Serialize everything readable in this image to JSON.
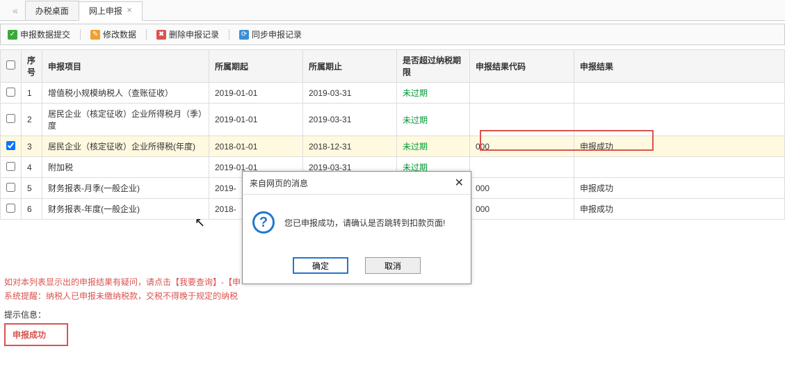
{
  "tabs": {
    "tab1": "办税桌面",
    "tab2": "网上申报"
  },
  "toolbar": {
    "submit": "申报数据提交",
    "modify": "修改数据",
    "delete": "删除申报记录",
    "sync": "同步申报记录"
  },
  "headers": {
    "seq": "序号",
    "item": "申报项目",
    "start": "所属期起",
    "end": "所属期止",
    "over": "是否超过纳税期限",
    "code": "申报结果代码",
    "result": "申报结果"
  },
  "rows": [
    {
      "seq": "1",
      "item": "增值税小规模纳税人（查账征收）",
      "start": "2019-01-01",
      "end": "2019-03-31",
      "over": "未过期",
      "code": "",
      "result": "",
      "checked": false
    },
    {
      "seq": "2",
      "item": "居民企业（核定征收）企业所得税月（季）度",
      "start": "2019-01-01",
      "end": "2019-03-31",
      "over": "未过期",
      "code": "",
      "result": "",
      "checked": false
    },
    {
      "seq": "3",
      "item": "居民企业（核定征收）企业所得税(年度)",
      "start": "2018-01-01",
      "end": "2018-12-31",
      "over": "未过期",
      "code": "000",
      "result": "申报成功",
      "checked": true,
      "selected": true
    },
    {
      "seq": "4",
      "item": "附加税",
      "start": "2019-01-01",
      "end": "2019-03-31",
      "over": "未过期",
      "code": "",
      "result": "",
      "checked": false
    },
    {
      "seq": "5",
      "item": "财务报表-月季(一般企业)",
      "start": "2019-",
      "end": "",
      "over": "",
      "code": "000",
      "result": "申报成功",
      "checked": false
    },
    {
      "seq": "6",
      "item": "财务报表-年度(一般企业)",
      "start": "2018-",
      "end": "",
      "over": "",
      "code": "000",
      "result": "申报成功",
      "checked": false
    }
  ],
  "notes": {
    "line1": "如对本列表显示出的申报结果有疑问，请点击【我要查询】-【申",
    "line2": "系统提醒：纳税人已申报未缴纳税款，交税不得晚于规定的纳税"
  },
  "hint": {
    "label": "提示信息：",
    "value": "申报成功"
  },
  "dialog": {
    "title": "来自网页的消息",
    "message": "您已申报成功，请确认是否跳转到扣款页面!",
    "ok": "确定",
    "cancel": "取消"
  }
}
